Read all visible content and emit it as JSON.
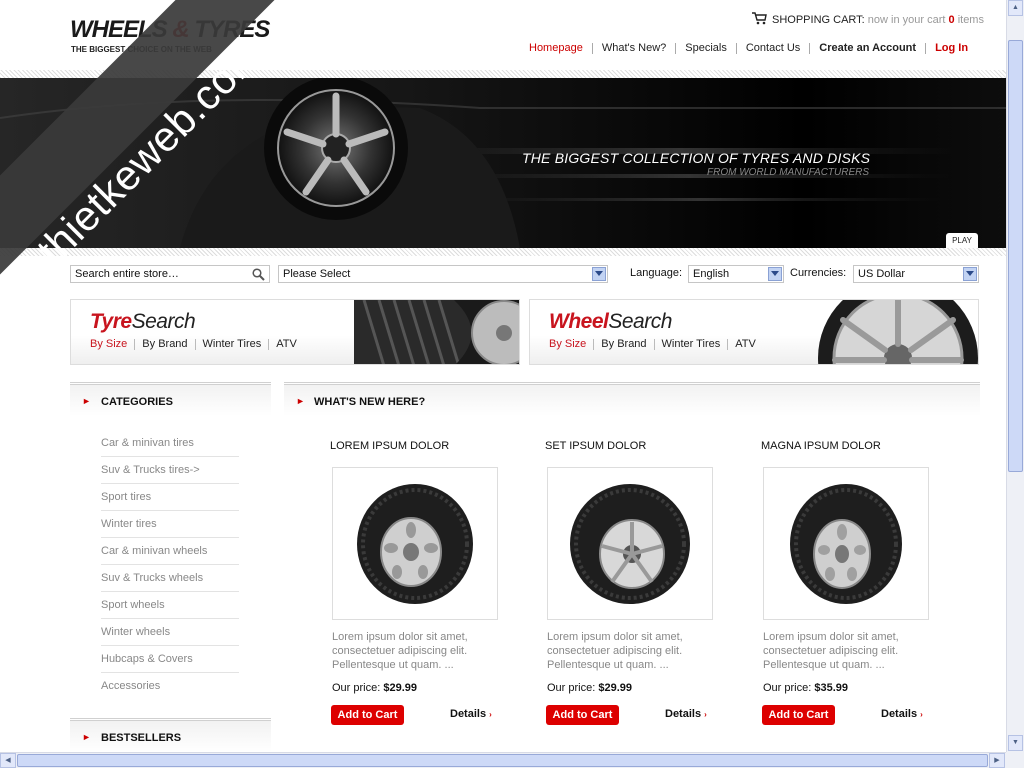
{
  "header": {
    "logo_main": "WHEELS ",
    "logo_amp": "&",
    "logo_end": " TYRES",
    "tagline": "THE BIGGEST CHOICE ON THE WEB",
    "cart": {
      "label": "SHOPPING CART:",
      "prefix": "now in your cart",
      "count": "0",
      "suffix": "items"
    },
    "nav": [
      "Homepage",
      "What's New?",
      "Specials",
      "Contact Us",
      "Create an Account",
      "Log In"
    ]
  },
  "banner": {
    "title": "THE BIGGEST COLLECTION OF TYRES AND DISKS",
    "subtitle": "FROM WORLD MANUFACTURERS",
    "play_label": "PLAY"
  },
  "toolbar": {
    "search_placeholder": "Search entire store…",
    "category_select": "Please Select",
    "language_label": "Language:",
    "language_value": "English",
    "currency_label": "Currencies:",
    "currency_value": "US Dollar"
  },
  "tyre_search": {
    "title_red": "Tyre",
    "title_black": "Search",
    "links": [
      "By Size",
      "By Brand",
      "Winter Tires",
      "ATV"
    ]
  },
  "wheel_search": {
    "title_red": "Wheel",
    "title_black": "Search",
    "links": [
      "By Size",
      "By Brand",
      "Winter Tires",
      "ATV"
    ]
  },
  "sidebar": {
    "categories_title": "CATEGORIES",
    "categories": [
      "Car & minivan tires",
      "Suv & Trucks tires->",
      "Sport tires",
      "Winter tires",
      "Car & minivan wheels",
      "Suv & Trucks wheels",
      "Sport wheels",
      "Winter wheels",
      "Hubcaps & Covers",
      "Accessories"
    ],
    "bestsellers_title": "BESTSELLERS"
  },
  "main": {
    "section_title": "WHAT'S NEW HERE?",
    "products": [
      {
        "name": "LOREM IPSUM DOLOR",
        "description": "Lorem ipsum dolor sit amet, consectetuer adipiscing elit. Pellentesque ut quam. ...",
        "price_label": "Our price:",
        "price": "$29.99",
        "add_label": "Add to Cart",
        "details_label": "Details"
      },
      {
        "name": "SET IPSUM DOLOR",
        "description": "Lorem ipsum dolor sit amet, consectetuer adipiscing elit. Pellentesque ut quam. ...",
        "price_label": "Our price:",
        "price": "$29.99",
        "add_label": "Add to Cart",
        "details_label": "Details"
      },
      {
        "name": "MAGNA IPSUM DOLOR",
        "description": "Lorem ipsum dolor sit amet, consectetuer adipiscing elit. Pellentesque ut quam. ...",
        "price_label": "Our price:",
        "price": "$35.99",
        "add_label": "Add to Cart",
        "details_label": "Details"
      }
    ]
  },
  "watermark": "thietkeweb.com",
  "colors": {
    "accent": "#cc0000",
    "text": "#222222",
    "muted": "#888888",
    "banner": "#111111"
  },
  "icons": [
    "cart-icon",
    "search-icon",
    "dropdown-arrow-icon",
    "bullet-arrow-icon",
    "chevron-right-icon"
  ]
}
